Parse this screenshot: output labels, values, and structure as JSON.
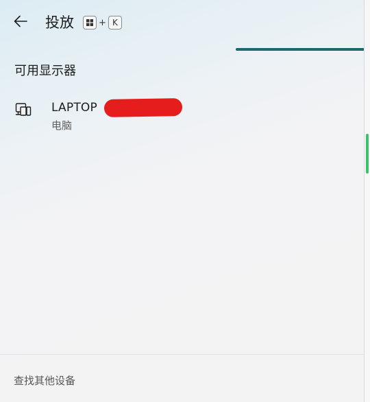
{
  "header": {
    "title": "投放",
    "shortcut": {
      "key_plus": "+",
      "key_letter": "K"
    }
  },
  "progress": {
    "fraction": 1.0,
    "color": "#1d6a6e"
  },
  "available_displays": {
    "heading": "可用显示器",
    "devices": [
      {
        "name": "LAPTOP",
        "type": "电脑",
        "icon": "laptop-phone-icon",
        "name_redacted": true
      }
    ]
  },
  "footer": {
    "find_other_devices": "查找其他设备"
  },
  "colors": {
    "accent_progress": "#1d6a6e",
    "redaction": "#e61d1d",
    "scroll_accent": "#3cc36a"
  }
}
